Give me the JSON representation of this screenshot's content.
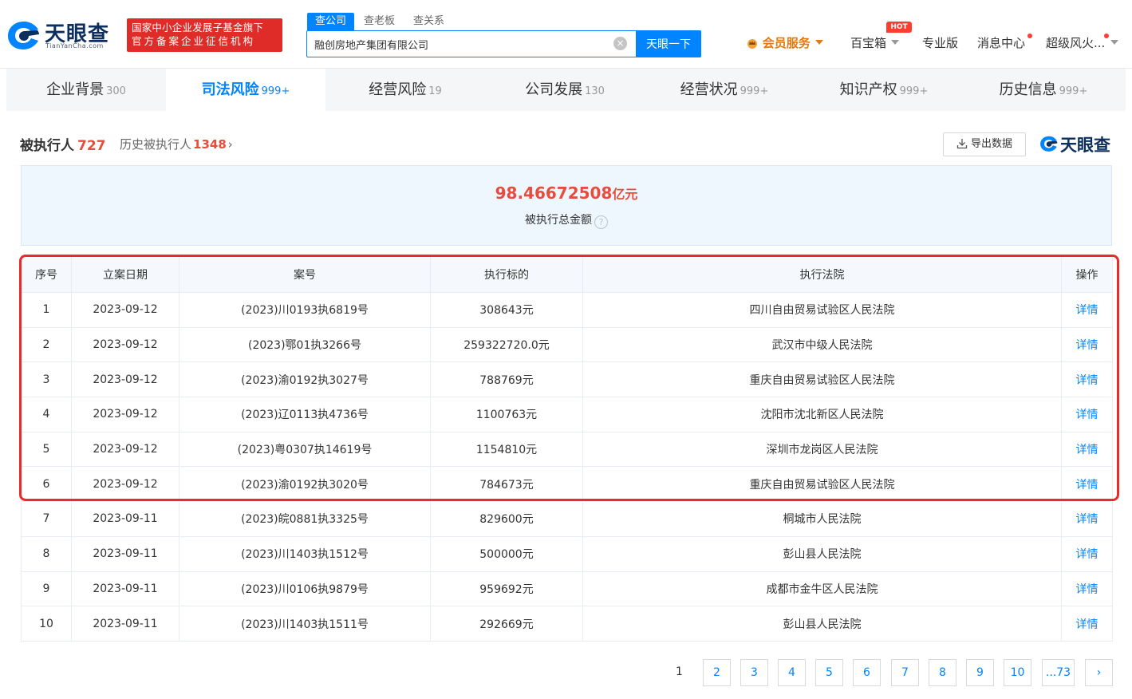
{
  "header": {
    "logo_name": "天眼查",
    "logo_sub": "TianYanCha.com",
    "gov_line1": "国家中小企业发展子基金旗下",
    "gov_line2": "官方备案企业征信机构",
    "search_tabs": [
      "查公司",
      "查老板",
      "查关系"
    ],
    "search_value": "融创房地产集团有限公司",
    "search_button": "天眼一下",
    "nav": {
      "vip": "会员服务",
      "baibaoxiang": "百宝箱",
      "hot": "HOT",
      "pro": "专业版",
      "messages": "消息中心",
      "user": "超级风火..."
    }
  },
  "categories": [
    {
      "label": "企业背景",
      "count": "300"
    },
    {
      "label": "司法风险",
      "count": "999+"
    },
    {
      "label": "经营风险",
      "count": "19"
    },
    {
      "label": "公司发展",
      "count": "130"
    },
    {
      "label": "经营状况",
      "count": "999+"
    },
    {
      "label": "知识产权",
      "count": "999+"
    },
    {
      "label": "历史信息",
      "count": "999+"
    }
  ],
  "section": {
    "title": "被执行人",
    "count": "727",
    "history_label": "历史被执行人",
    "history_count": "1348",
    "export_label": "导出数据",
    "watermark": "天眼查"
  },
  "summary": {
    "amount": "98.46672508",
    "unit": "亿元",
    "label": "被执行总金额",
    "help": "?"
  },
  "table": {
    "headers": [
      "序号",
      "立案日期",
      "案号",
      "执行标的",
      "执行法院",
      "操作"
    ],
    "rows": [
      [
        "1",
        "2023-09-12",
        "(2023)川0193执6819号",
        "308643元",
        "四川自由贸易试验区人民法院",
        "详情"
      ],
      [
        "2",
        "2023-09-12",
        "(2023)鄂01执3266号",
        "259322720.0元",
        "武汉市中级人民法院",
        "详情"
      ],
      [
        "3",
        "2023-09-12",
        "(2023)渝0192执3027号",
        "788769元",
        "重庆自由贸易试验区人民法院",
        "详情"
      ],
      [
        "4",
        "2023-09-12",
        "(2023)辽0113执4736号",
        "1100763元",
        "沈阳市沈北新区人民法院",
        "详情"
      ],
      [
        "5",
        "2023-09-12",
        "(2023)粤0307执14619号",
        "1154810元",
        "深圳市龙岗区人民法院",
        "详情"
      ],
      [
        "6",
        "2023-09-12",
        "(2023)渝0192执3020号",
        "784673元",
        "重庆自由贸易试验区人民法院",
        "详情"
      ],
      [
        "7",
        "2023-09-11",
        "(2023)皖0881执3325号",
        "829600元",
        "桐城市人民法院",
        "详情"
      ],
      [
        "8",
        "2023-09-11",
        "(2023)川1403执1512号",
        "500000元",
        "彭山县人民法院",
        "详情"
      ],
      [
        "9",
        "2023-09-11",
        "(2023)川0106执9879号",
        "959692元",
        "成都市金牛区人民法院",
        "详情"
      ],
      [
        "10",
        "2023-09-11",
        "(2023)川1403执1511号",
        "292669元",
        "彭山县人民法院",
        "详情"
      ]
    ]
  },
  "pagination": {
    "current": "1",
    "pages": [
      "2",
      "3",
      "4",
      "5",
      "6",
      "7",
      "8",
      "9",
      "10",
      "...73"
    ],
    "next": "›"
  },
  "colors": {
    "accent": "#0084ff",
    "danger": "#e74c3c",
    "highlight": "#ea2b2b",
    "vip": "#e8780e"
  }
}
